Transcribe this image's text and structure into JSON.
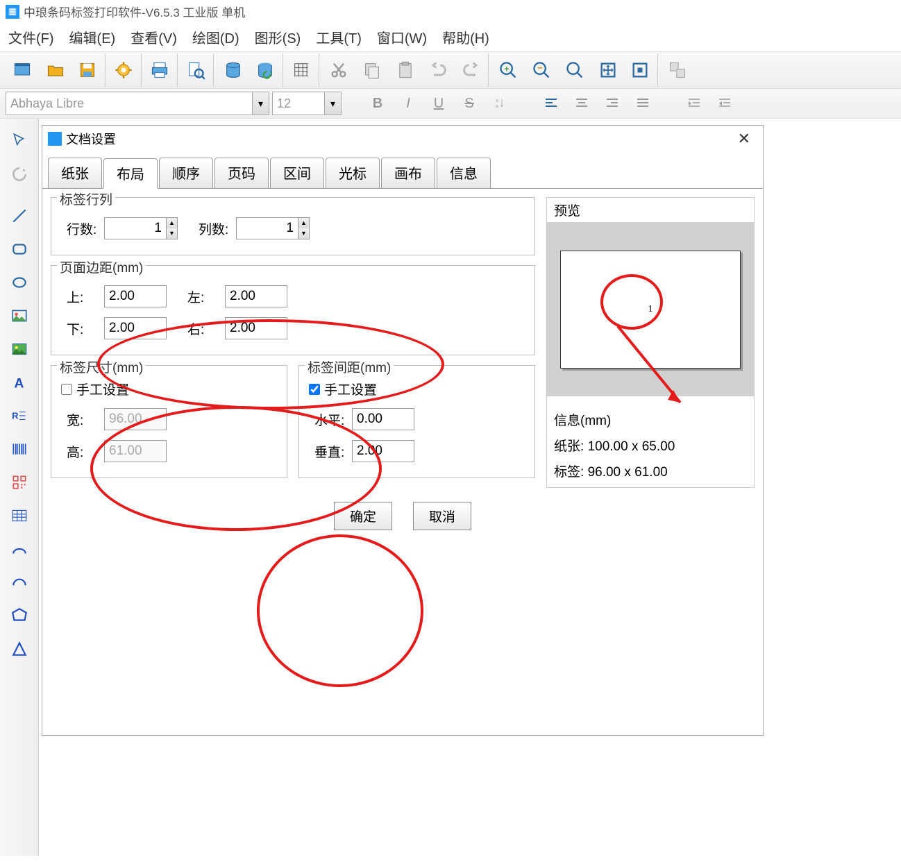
{
  "titlebar": {
    "text": "中琅条码标签打印软件-V6.5.3 工业版 单机"
  },
  "menu": {
    "file": "文件(F)",
    "edit": "编辑(E)",
    "view": "查看(V)",
    "draw": "绘图(D)",
    "shape": "图形(S)",
    "tool": "工具(T)",
    "window": "窗口(W)",
    "help": "帮助(H)"
  },
  "formatbar": {
    "font_name": "Abhaya Libre",
    "font_size": "12",
    "bold": "B",
    "italic": "I",
    "underline": "U",
    "strike": "S"
  },
  "dialog": {
    "title": "文档设置",
    "tabs": {
      "paper": "纸张",
      "layout": "布局",
      "order": "顺序",
      "pageno": "页码",
      "range": "区间",
      "cursor": "光标",
      "canvas": "画布",
      "info": "信息"
    },
    "rows_cols": {
      "label": "标签行列",
      "rows_label": "行数:",
      "rows_value": "1",
      "cols_label": "列数:",
      "cols_value": "1"
    },
    "margins": {
      "label": "页面边距(mm)",
      "top_label": "上:",
      "top_value": "2.00",
      "left_label": "左:",
      "left_value": "2.00",
      "bottom_label": "下:",
      "bottom_value": "2.00",
      "right_label": "右:",
      "right_value": "2.00"
    },
    "size": {
      "label": "标签尺寸(mm)",
      "manual_label": "手工设置",
      "manual_checked": false,
      "width_label": "宽:",
      "width_value": "96.00",
      "height_label": "高:",
      "height_value": "61.00"
    },
    "spacing": {
      "label": "标签间距(mm)",
      "manual_label": "手工设置",
      "manual_checked": true,
      "horiz_label": "水平:",
      "horiz_value": "0.00",
      "vert_label": "垂直:",
      "vert_value": "2.00"
    },
    "preview": {
      "label": "预览",
      "page_number": "1"
    },
    "info_panel": {
      "label": "信息(mm)",
      "paper_label": "纸张:",
      "paper_value": "100.00 x 65.00",
      "tag_label": "标签:",
      "tag_value": "96.00 x 61.00"
    },
    "buttons": {
      "ok": "确定",
      "cancel": "取消"
    }
  }
}
